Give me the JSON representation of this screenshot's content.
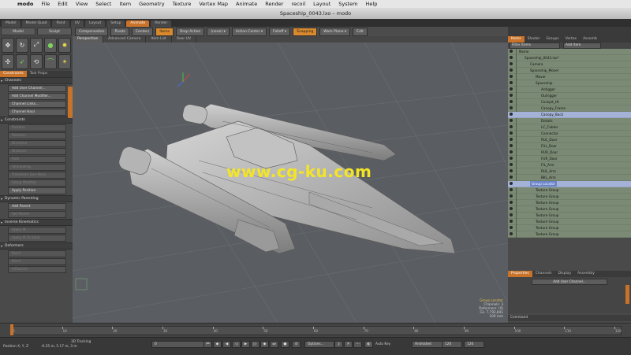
{
  "menubar": {
    "items": [
      "modo",
      "File",
      "Edit",
      "View",
      "Select",
      "Item",
      "Geometry",
      "Texture",
      "Vertex Map",
      "Animate",
      "Render",
      "recoil",
      "Layout",
      "System",
      "Help"
    ]
  },
  "window": {
    "title": "Spaceship_0043.lxo – modo"
  },
  "layout_tabs": [
    "Model",
    "Model Quad",
    "Paint",
    "UV",
    "Layout",
    "Setup",
    "Animate",
    "Render"
  ],
  "tools_header": {
    "left": "Model",
    "right": "Sculpt"
  },
  "toolbar": {
    "items": [
      {
        "label": "Compensation",
        "style": "plain",
        "dd": false
      },
      {
        "label": "Pivots",
        "style": "plain",
        "dd": false
      },
      {
        "label": "Centers",
        "style": "plain",
        "dd": false
      },
      {
        "label": "Items",
        "style": "orange",
        "dd": false
      },
      {
        "label": "Drop Action",
        "style": "plain",
        "dd": false
      },
      {
        "label": "(none)",
        "style": "plain",
        "dd": true
      },
      {
        "label": "Action Center",
        "style": "plain",
        "dd": true
      },
      {
        "label": "Falloff",
        "style": "plain",
        "dd": true
      },
      {
        "label": "Snapping",
        "style": "orange",
        "dd": false
      },
      {
        "label": "Work Plane",
        "style": "plain",
        "dd": true
      },
      {
        "label": "Edit",
        "style": "plain",
        "dd": false
      }
    ]
  },
  "left_panel": {
    "tabs": [
      "Constraints",
      "Tool Props"
    ],
    "sections": [
      {
        "title": "Channels",
        "buttons": [
          {
            "label": "Add User Channel...",
            "dim": false
          },
          {
            "label": "Add Channel Modifier...",
            "dim": false
          },
          {
            "label": "Channel Links...",
            "dim": false
          },
          {
            "label": "Channel Haul",
            "dim": false
          }
        ]
      },
      {
        "title": "Constraints",
        "buttons": [
          {
            "label": "Position",
            "dim": true
          },
          {
            "label": "Rotation",
            "dim": true
          },
          {
            "label": "Direction",
            "dim": true
          },
          {
            "label": "Distance",
            "dim": true
          },
          {
            "label": "Path",
            "dim": true
          },
          {
            "label": "Shrinkwrap",
            "dim": true
          },
          {
            "label": "Transform Gen Neck",
            "dim": true
          },
          {
            "label": "Setup Modifier",
            "dim": true
          },
          {
            "label": "Apply Position",
            "dim": false
          }
        ]
      },
      {
        "title": "Dynamic Parenting",
        "buttons": [
          {
            "label": "Add Parent",
            "dim": false
          },
          {
            "label": "Set Parent",
            "dim": true
          }
        ]
      },
      {
        "title": "Inverse Kinematics",
        "buttons": [
          {
            "label": "Apply IK",
            "dim": true
          },
          {
            "label": "Apply IK To Solid",
            "dim": true
          }
        ]
      },
      {
        "title": "Deformers",
        "buttons": [
          {
            "label": "Bend",
            "dim": true
          },
          {
            "label": "Bend",
            "dim": true
          },
          {
            "label": "Influence",
            "dim": true
          }
        ]
      }
    ]
  },
  "viewport": {
    "tabs": [
      "Perspective",
      "Advanced Camera",
      "Item List",
      "Rear UV"
    ],
    "watermark": "www.cg-ku.com",
    "info_lines": [
      "Group Locator",
      "Channels: 3",
      "Deformers: (0)",
      "GL: 7,792,841",
      "100 mm"
    ]
  },
  "right_panel": {
    "tabs": [
      "Items",
      "Shader",
      "Groups",
      "Vertex",
      "Assemb"
    ],
    "filter": "Filter Items",
    "add_item": "Add Item",
    "tree": [
      {
        "label": "Name",
        "depth": 0,
        "sel": false,
        "hl": false
      },
      {
        "label": "Spaceship_0043.lxo*",
        "depth": 1,
        "sel": false,
        "hl": false
      },
      {
        "label": "Camera",
        "depth": 2,
        "sel": false,
        "hl": false
      },
      {
        "label": "Spaceship_Mover",
        "depth": 2,
        "sel": false,
        "hl": false
      },
      {
        "label": "Mover",
        "depth": 3,
        "sel": false,
        "hl": false
      },
      {
        "label": "Spaceship",
        "depth": 3,
        "sel": false,
        "hl": false
      },
      {
        "label": "Antigger",
        "depth": 4,
        "sel": false,
        "hl": false
      },
      {
        "label": "Outrigger",
        "depth": 4,
        "sel": false,
        "hl": false
      },
      {
        "label": "Cockpit_Ht",
        "depth": 4,
        "sel": false,
        "hl": false
      },
      {
        "label": "Canopy_Frame",
        "depth": 4,
        "sel": false,
        "hl": false
      },
      {
        "label": "Canopy_Back",
        "depth": 4,
        "sel": true,
        "hl": false
      },
      {
        "label": "Details",
        "depth": 4,
        "sel": false,
        "hl": false
      },
      {
        "label": "LC_Cables",
        "depth": 4,
        "sel": false,
        "hl": false
      },
      {
        "label": "Connector",
        "depth": 4,
        "sel": false,
        "hl": false
      },
      {
        "label": "RUL_Door",
        "depth": 4,
        "sel": false,
        "hl": false
      },
      {
        "label": "FUL_Door",
        "depth": 4,
        "sel": false,
        "hl": false
      },
      {
        "label": "RUR_Door",
        "depth": 4,
        "sel": false,
        "hl": false
      },
      {
        "label": "FUR_Door",
        "depth": 4,
        "sel": false,
        "hl": false
      },
      {
        "label": "FlL_Arm",
        "depth": 4,
        "sel": false,
        "hl": false
      },
      {
        "label": "RUL_Arm",
        "depth": 4,
        "sel": false,
        "hl": false
      },
      {
        "label": "BKL_Arm",
        "depth": 4,
        "sel": false,
        "hl": false
      },
      {
        "label": "Group Locator",
        "depth": 2,
        "sel": true,
        "hl": true
      },
      {
        "label": "Texture Group",
        "depth": 3,
        "sel": false,
        "hl": false
      },
      {
        "label": "Texture Group",
        "depth": 3,
        "sel": false,
        "hl": false
      },
      {
        "label": "Texture Group",
        "depth": 3,
        "sel": false,
        "hl": false
      },
      {
        "label": "Texture Group",
        "depth": 3,
        "sel": false,
        "hl": false
      },
      {
        "label": "Texture Group",
        "depth": 3,
        "sel": false,
        "hl": false
      },
      {
        "label": "Texture Group",
        "depth": 3,
        "sel": false,
        "hl": false
      },
      {
        "label": "Texture Group",
        "depth": 3,
        "sel": false,
        "hl": false
      },
      {
        "label": "Texture Group",
        "depth": 3,
        "sel": false,
        "hl": false
      },
      {
        "label": "Texture Group",
        "depth": 3,
        "sel": false,
        "hl": false
      },
      {
        "label": "Texture Group",
        "depth": 3,
        "sel": false,
        "hl": false
      }
    ],
    "props_tabs": [
      "Properties",
      "Channels",
      "Display",
      "Assembly"
    ],
    "props_button": "Add User Channel...",
    "command_label": "Command"
  },
  "timeline": {
    "ticks": [
      "0",
      "10",
      "20",
      "30",
      "40",
      "50",
      "60",
      "70",
      "80",
      "90",
      "100",
      "110",
      "120"
    ]
  },
  "bottombar": {
    "position": "Position X, Y, Z",
    "coords": "-6.25 m, 5.17 m, 3 m",
    "mode": "3D Tracking",
    "frame": "0",
    "options": "Options...",
    "autokey_label": "Auto Key",
    "autokey_value": "Animated",
    "range_start": "120",
    "range_end": "120"
  }
}
